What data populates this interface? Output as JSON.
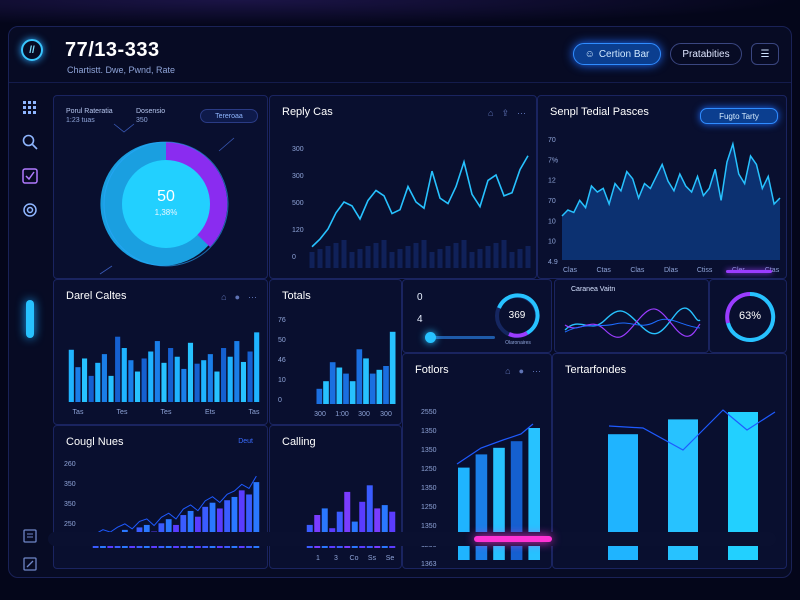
{
  "header": {
    "title": "77/13-333",
    "subtitle": "Chartistt. Dwe, Pwnd, Rate",
    "logo_text": "//",
    "primary_button": "Certion Bar",
    "secondary_button": "Pratabities",
    "menu_icon": "list-icon"
  },
  "sidebar": {
    "icons": [
      "grid-icon",
      "search-icon",
      "check-square-icon",
      "settings-icon",
      "document-icon",
      "edit-icon"
    ]
  },
  "colors": {
    "accent": "#27c2ff",
    "purple": "#9b3cff",
    "magenta": "#ff33d6",
    "background": "#070b24"
  },
  "donut_panel": {
    "legend_a_label": "Porul Rateratia",
    "legend_a_value": "1:23 tuas",
    "legend_b_label": "Dosensio",
    "legend_b_value": "350",
    "pill": "Tereroaa",
    "center_value": "50",
    "center_sub": "1,38%"
  },
  "reply_panel": {
    "title": "Reply Cas",
    "yticks": [
      "300",
      "300",
      "500",
      "120",
      "0"
    ]
  },
  "senpl_panel": {
    "title": "Senpl Tedial Pasces",
    "pill": "Fugto Tarty",
    "yticks": [
      "70",
      "7%",
      "12",
      "70",
      "10",
      "10",
      "4.9"
    ],
    "xticks": [
      "Clas",
      "Ctas",
      "Clas",
      "Dlas",
      "Ctiss",
      "Cler",
      "Ctas"
    ]
  },
  "darel_panel": {
    "title": "Darel Caltes",
    "xticks": [
      "Tas",
      "Tes",
      "Tes",
      "Ets",
      "Tas"
    ]
  },
  "totals_panel": {
    "title": "Totals",
    "yticks": [
      "76",
      "50",
      "46",
      "10",
      "0"
    ],
    "xticks": [
      "300",
      "1:00",
      "300",
      "300"
    ]
  },
  "stat_panel": {
    "label_top": "0",
    "label_mid": "4",
    "gauge_value": "369",
    "gauge_caption": "Olaronaires"
  },
  "wave_panel": {
    "title": "Caranea Vaitn"
  },
  "ring_panel": {
    "value": "63%"
  },
  "cougl_panel": {
    "title": "Cougl Nues",
    "tag": "Deut",
    "yticks": [
      "260",
      "350",
      "350",
      "250",
      "0"
    ]
  },
  "calling_panel": {
    "title": "Calling",
    "xticks": [
      "1",
      "3",
      "Co",
      "Ss",
      "Se"
    ]
  },
  "fotlors_panel": {
    "title": "Fotlors",
    "yticks": [
      "2550",
      "1350",
      "1350",
      "1250",
      "1350",
      "1250",
      "1350",
      "1250",
      "1363"
    ]
  },
  "tertar_panel": {
    "title": "Tertarfondes"
  },
  "chart_data": [
    {
      "type": "line",
      "title": "Reply Cas",
      "x": [
        1,
        2,
        3,
        4,
        5,
        6,
        7,
        8,
        9,
        10,
        11,
        12,
        13,
        14,
        15,
        16,
        17,
        18,
        19,
        20,
        21,
        22,
        23,
        24,
        25,
        26,
        27,
        28
      ],
      "values": [
        12,
        22,
        35,
        56,
        70,
        65,
        48,
        72,
        85,
        78,
        55,
        60,
        90,
        70,
        62,
        110,
        75,
        68,
        90,
        122,
        80,
        64,
        98,
        105,
        78,
        82,
        112,
        130
      ]
    },
    {
      "type": "area",
      "title": "Senpl Tedial Pasces",
      "categories": [
        "Clas",
        "Ctas",
        "Clas",
        "Dlas",
        "Ctiss",
        "Cler",
        "Ctas"
      ],
      "values": [
        35,
        40,
        38,
        48,
        42,
        60,
        55,
        58,
        45,
        62,
        56,
        72,
        66,
        50,
        62,
        58,
        68,
        78,
        64,
        56,
        70,
        60,
        55,
        68,
        52,
        58,
        74,
        48,
        80,
        95,
        70,
        62,
        85,
        78,
        58,
        68,
        45,
        50
      ]
    },
    {
      "type": "bar",
      "title": "Darel Caltes",
      "categories": [
        "Tas",
        "Tes",
        "Tes",
        "Ets",
        "Tas"
      ],
      "values": [
        60,
        40,
        50,
        30,
        45,
        55,
        30,
        75,
        62,
        48,
        35,
        50,
        58,
        70,
        45,
        62,
        52,
        38,
        68,
        44,
        48,
        55,
        35,
        62,
        52,
        70,
        46,
        58,
        80
      ]
    },
    {
      "type": "bar",
      "title": "Totals",
      "categories": [
        "300",
        "1:00",
        "300",
        "300"
      ],
      "values": [
        20,
        30,
        55,
        48,
        40,
        30,
        72,
        60,
        40,
        45,
        50,
        95
      ]
    },
    {
      "type": "bar",
      "title": "Cougl Nues",
      "values": [
        10,
        15,
        12,
        18,
        22,
        16,
        25,
        28,
        20,
        30,
        35,
        28,
        40,
        45,
        38,
        50,
        55,
        48,
        58,
        62,
        70,
        65,
        80
      ]
    },
    {
      "type": "bar",
      "title": "Calling",
      "categories": [
        "1",
        "3",
        "Co",
        "Ss",
        "Se"
      ],
      "values": [
        35,
        50,
        60,
        30,
        55,
        85,
        40,
        70,
        95,
        60,
        65,
        55
      ]
    },
    {
      "type": "bar",
      "title": "Fotlors",
      "values": [
        70,
        80,
        85,
        90,
        100
      ]
    },
    {
      "type": "bar",
      "title": "Tertarfondes",
      "values": [
        85,
        95,
        100
      ]
    }
  ]
}
